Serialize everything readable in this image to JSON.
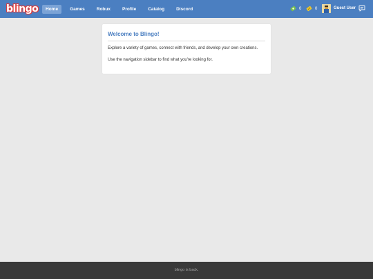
{
  "brand": {
    "logo": "blingo",
    "logo_color": "#e03b3b"
  },
  "nav": {
    "items": [
      {
        "label": "Home",
        "active": true
      },
      {
        "label": "Games"
      },
      {
        "label": "Robux"
      },
      {
        "label": "Profile"
      },
      {
        "label": "Catalog"
      },
      {
        "label": "Discord"
      }
    ]
  },
  "header": {
    "robux_count": "0",
    "tickets_count": "0",
    "username": "Guest User",
    "robux_icon": "robux-icon",
    "tickets_icon": "tickets-icon",
    "chat_icon": "chat-icon"
  },
  "welcome": {
    "title": "Welcome to Blingo!",
    "line1": "Explore a variety of games, connect with friends, and develop your own creations.",
    "line2": "Use the navigation sidebar to find what you're looking for."
  },
  "footer": {
    "text": "blingo is back."
  },
  "colors": {
    "navbar": "#4b7fc1",
    "page_bg": "#e9e9e9",
    "footer_bg": "#393939",
    "accent": "#4b7fc1"
  }
}
